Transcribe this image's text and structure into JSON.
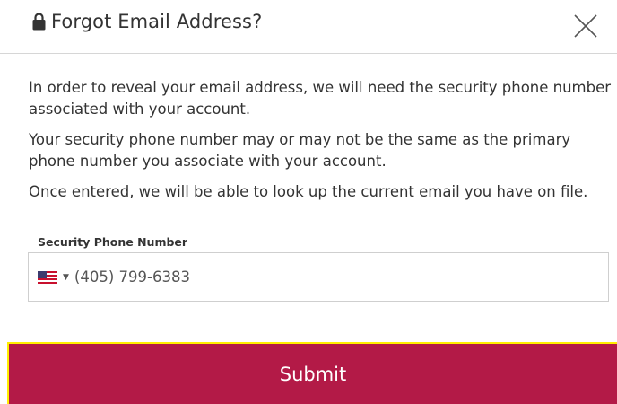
{
  "header": {
    "title": "Forgot Email Address?",
    "lock_icon": "lock-icon",
    "close_icon": "close-icon"
  },
  "body": {
    "paragraphs": [
      "In order to reveal your email address, we will need the security phone number associated with your account.",
      "Your security phone number may or may not be the same as the primary phone number you associate with your account.",
      "Once entered, we will be able to look up the current email you have on file."
    ]
  },
  "form": {
    "phone_label": "Security Phone Number",
    "country_flag_icon": "us-flag-icon",
    "phone_value": "(405) 799-6383"
  },
  "actions": {
    "submit_label": "Submit"
  },
  "colors": {
    "submit_background": "#b31a47",
    "focus_outline": "#ffee00",
    "text": "#333333"
  }
}
